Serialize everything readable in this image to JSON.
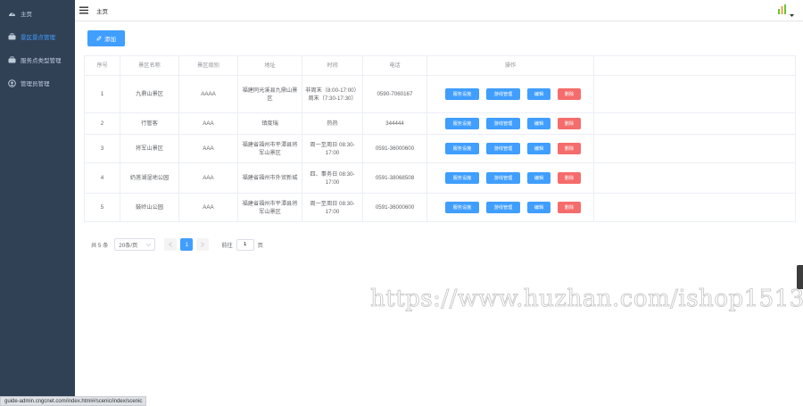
{
  "sidebar": {
    "items": [
      {
        "label": "主页",
        "icon": "dashboard-icon",
        "active": false
      },
      {
        "label": "景区景点管理",
        "icon": "scenic-icon",
        "active": true
      },
      {
        "label": "服务点类型管理",
        "icon": "service-icon",
        "active": false
      },
      {
        "label": "管理员管理",
        "icon": "user-icon",
        "active": false
      }
    ]
  },
  "header": {
    "breadcrumb": "主页",
    "logo_icon": "bars-logo-icon",
    "dropdown_icon": "caret-down-icon"
  },
  "toolbar": {
    "add_label": "添加",
    "add_icon": "edit-icon"
  },
  "table": {
    "columns": [
      "序号",
      "景区名称",
      "景区级别",
      "地址",
      "时间",
      "电话",
      "操作"
    ],
    "rows": [
      {
        "no": "1",
        "name": "九鼎山景区",
        "level": "AAAA",
        "address": "福建同光溪县九鼎山景区",
        "time": "非周末（8:00-17:00）周末（7:30-17:30）",
        "phone": "0590-7060167",
        "actions": [
          "服务设施",
          "游线管理",
          "编辑",
          "删除"
        ]
      },
      {
        "no": "2",
        "name": "行管客",
        "level": "AAA",
        "address": "镇度瑞",
        "time": "热热",
        "phone": "344444",
        "actions": [
          "服务设施",
          "游线管理",
          "编辑",
          "删除"
        ]
      },
      {
        "no": "3",
        "name": "将军山景区",
        "level": "AAA",
        "address": "福建省福州市平潭县将军山景区",
        "time": "周一至周日 08:30-17:00",
        "phone": "0591-36000600",
        "actions": [
          "服务设施",
          "游线管理",
          "编辑",
          "删除"
        ]
      },
      {
        "no": "4",
        "name": "奶莲湖湿地公园",
        "level": "AAA",
        "address": "福建省福州市外贸新城",
        "time": "四、事务日 08:30-17:00",
        "phone": "0591-38068508",
        "actions": [
          "服务设施",
          "游线管理",
          "编辑",
          "删除"
        ]
      },
      {
        "no": "5",
        "name": "鼓岭山公园",
        "level": "AAA",
        "address": "福建省福州市平潭县将军山景区",
        "time": "周一至周日 08:30-17:00",
        "phone": "0591-36000600",
        "actions": [
          "服务设施",
          "游线管理",
          "编辑",
          "删除"
        ]
      }
    ]
  },
  "pagination": {
    "total_label": "共 5 条",
    "page_size": "20条/页",
    "current_page": "1",
    "goto_label": "前往",
    "goto_value": "1",
    "page_unit": "页"
  },
  "watermark": "https://www.huzhan.com/ishop15132",
  "statusbar": {
    "url": "guide-admin.cngcnet.com/index.html#/scenic/index/scenic"
  },
  "colors": {
    "primary": "#409eff",
    "danger": "#f56c6c",
    "sidebar": "#304156"
  }
}
